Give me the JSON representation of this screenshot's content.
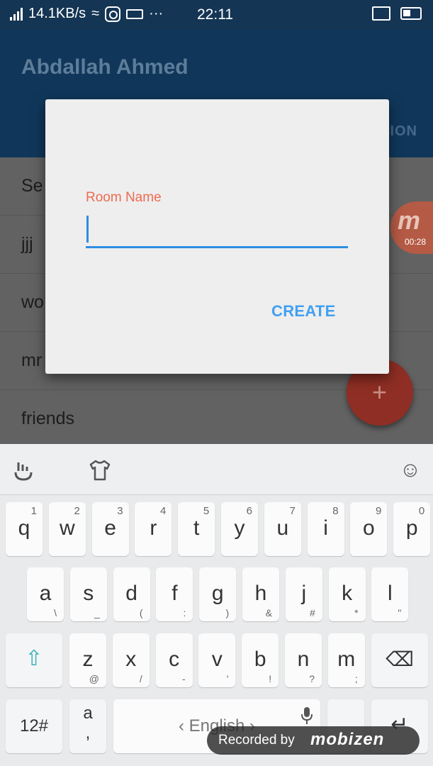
{
  "status_bar": {
    "speed": "14.1KB/s",
    "ellipsis": "···",
    "time": "22:11"
  },
  "app_bar": {
    "title": "Abdallah Ahmed",
    "tab_partial": "ION"
  },
  "list": {
    "items": [
      {
        "label": "Se"
      },
      {
        "label": "jjj"
      },
      {
        "label": "wo"
      },
      {
        "label": "mr"
      },
      {
        "label": "friends"
      }
    ]
  },
  "recorder_bubble": {
    "logo": "m",
    "elapsed": "00:28"
  },
  "fab": {
    "icon": "plus-icon",
    "symbol": "+"
  },
  "dialog": {
    "field_label": "Room Name",
    "field_value": "",
    "create_label": "CREATE",
    "colors": {
      "label": "#ef6a52",
      "underline": "#2f8de2",
      "button": "#42a0f0"
    }
  },
  "keyboard": {
    "toolbar": {
      "left_icon": "swype-hand-icon",
      "shirt_icon": "theme-shirt-icon",
      "emoji_icon": "emoji-icon",
      "emoji_symbol": "☺"
    },
    "row1": [
      {
        "main": "q",
        "sup": "1"
      },
      {
        "main": "w",
        "sup": "2"
      },
      {
        "main": "e",
        "sup": "3"
      },
      {
        "main": "r",
        "sup": "4"
      },
      {
        "main": "t",
        "sup": "5"
      },
      {
        "main": "y",
        "sup": "6"
      },
      {
        "main": "u",
        "sup": "7"
      },
      {
        "main": "i",
        "sup": "8"
      },
      {
        "main": "o",
        "sup": "9"
      },
      {
        "main": "p",
        "sup": "0"
      }
    ],
    "row2": [
      {
        "main": "a",
        "sub": "\\"
      },
      {
        "main": "s",
        "sub": "_"
      },
      {
        "main": "d",
        "sub": "("
      },
      {
        "main": "f",
        "sub": ":"
      },
      {
        "main": "g",
        "sub": ")"
      },
      {
        "main": "h",
        "sub": "&"
      },
      {
        "main": "j",
        "sub": "#"
      },
      {
        "main": "k",
        "sub": "*"
      },
      {
        "main": "l",
        "sub": "\""
      }
    ],
    "row3": [
      {
        "main": "z",
        "sub": "@"
      },
      {
        "main": "x",
        "sub": "/"
      },
      {
        "main": "c",
        "sub": "-"
      },
      {
        "main": "v",
        "sub": "'"
      },
      {
        "main": "b",
        "sub": "!"
      },
      {
        "main": "n",
        "sub": "?"
      },
      {
        "main": "m",
        "sub": ";"
      }
    ],
    "shift_symbol": "⇧",
    "backspace_symbol": "⌫",
    "numbers_label": "12#",
    "punct_main": "a",
    "punct_sub": ",",
    "space_label": "English",
    "space_left": "‹",
    "space_right": "›",
    "mic_icon": "microphone-icon",
    "enter_symbol": "↵"
  },
  "watermark": {
    "text": "Recorded by",
    "brand": "mobizen"
  }
}
